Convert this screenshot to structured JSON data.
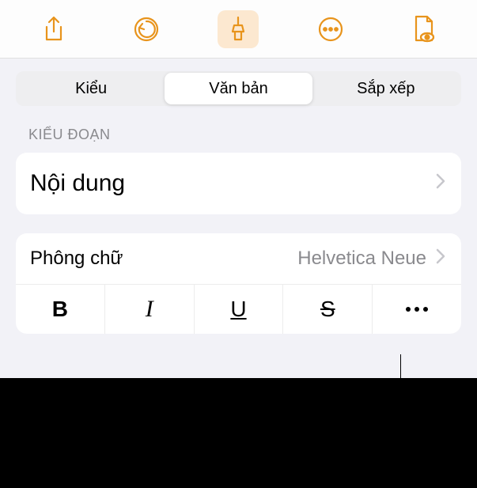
{
  "toolbar": {
    "share_icon": "share",
    "undo_icon": "undo",
    "format_icon": "format-brush",
    "more_icon": "more",
    "document_icon": "document-view"
  },
  "segments": {
    "style": "Kiểu",
    "text": "Văn bản",
    "arrange": "Sắp xếp"
  },
  "section": {
    "paragraph_style_label": "KIỂU ĐOẠN",
    "paragraph_style_value": "Nội dung"
  },
  "font": {
    "label": "Phông chữ",
    "value": "Helvetica Neue"
  },
  "styles": {
    "bold": "B",
    "italic": "I",
    "underline": "U",
    "strike": "S"
  },
  "colors": {
    "accent": "#f39c12",
    "accent_bg": "#fce8d0"
  }
}
